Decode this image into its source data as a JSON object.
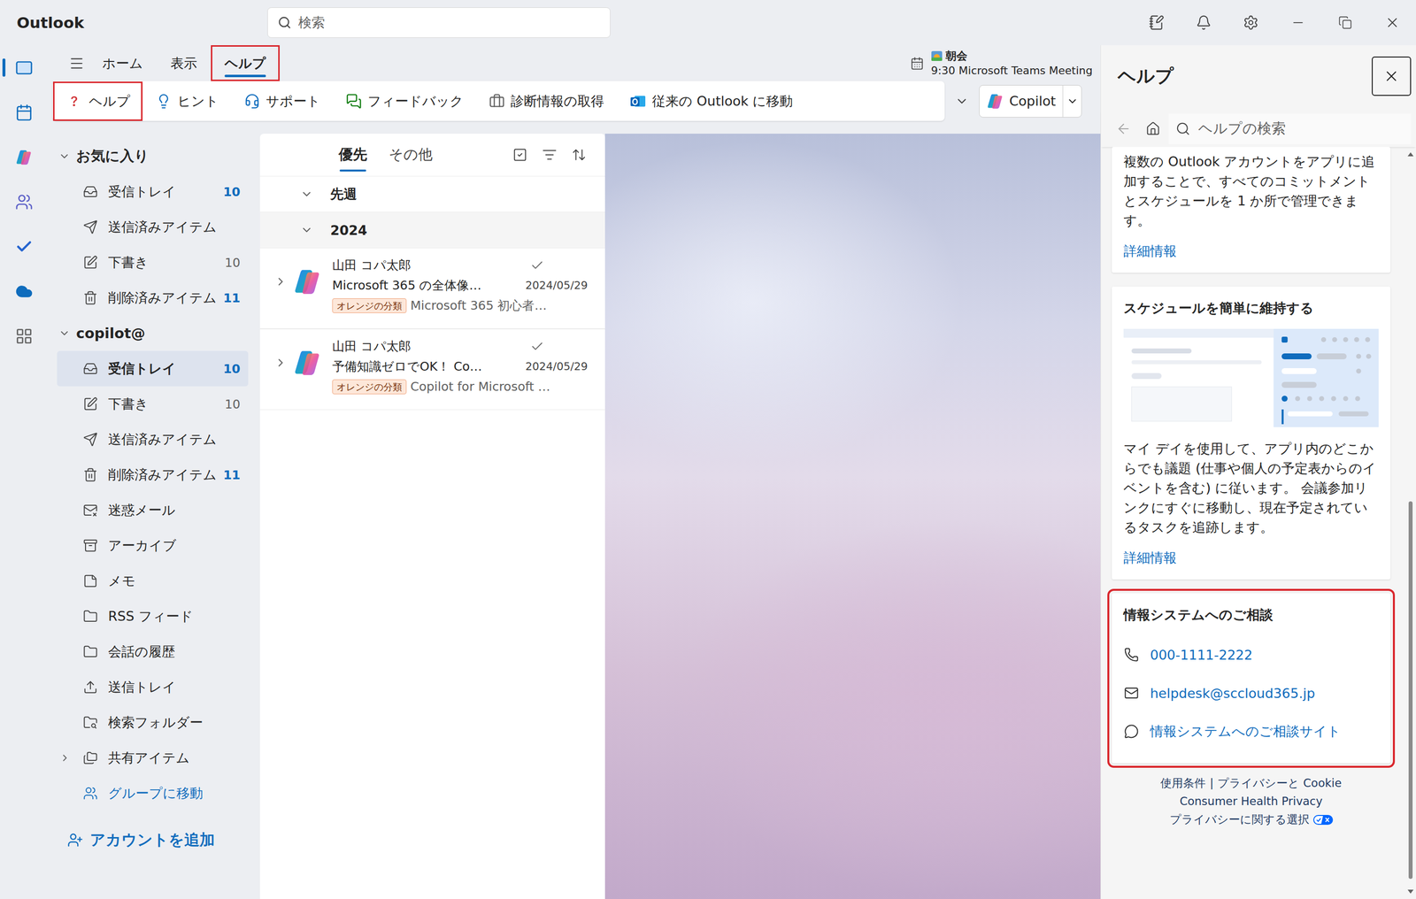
{
  "window": {
    "title": "Outlook"
  },
  "search": {
    "placeholder": "検索"
  },
  "rail": [
    {
      "kind": "mail",
      "selected": true
    },
    {
      "kind": "calendar",
      "selected": false
    },
    {
      "kind": "copilot",
      "selected": false
    },
    {
      "kind": "people",
      "selected": false
    },
    {
      "kind": "todo",
      "selected": false
    },
    {
      "kind": "onedrive",
      "selected": false
    },
    {
      "kind": "apps",
      "selected": false
    }
  ],
  "ribbon": {
    "tabs": [
      {
        "label": "ホーム",
        "selected": false,
        "highlighted": false
      },
      {
        "label": "表示",
        "selected": false,
        "highlighted": false
      },
      {
        "label": "ヘルプ",
        "selected": true,
        "highlighted": true
      }
    ],
    "buttons": [
      {
        "kind": "help",
        "label": "ヘルプ",
        "highlighted": true
      },
      {
        "kind": "tips",
        "label": "ヒント",
        "highlighted": false
      },
      {
        "kind": "support",
        "label": "サポート",
        "highlighted": false
      },
      {
        "kind": "feedback",
        "label": "フィードバック",
        "highlighted": false
      },
      {
        "kind": "diagnostics",
        "label": "診断情報の取得",
        "highlighted": false
      },
      {
        "kind": "classic",
        "label": "従来の Outlook に移動",
        "highlighted": false
      }
    ],
    "copilot": {
      "label": "Copilot"
    }
  },
  "upcoming": {
    "title": "朝会",
    "detail": "9:30 Microsoft Teams Meeting"
  },
  "folders": {
    "sections": [
      {
        "title": "お気に入り",
        "expanded": true,
        "items": [
          {
            "kind": "inbox",
            "label": "受信トレイ",
            "count": "10",
            "unread": true,
            "selected": false,
            "expandable": false
          },
          {
            "kind": "sent",
            "label": "送信済みアイテム",
            "unread": false,
            "selected": false,
            "expandable": false
          },
          {
            "kind": "drafts",
            "label": "下書き",
            "count": "10",
            "unread": false,
            "selected": false,
            "expandable": false
          },
          {
            "kind": "deleted",
            "label": "削除済みアイテム",
            "count": "11",
            "unread": true,
            "selected": false,
            "expandable": false
          }
        ]
      },
      {
        "title": "copilot@",
        "expanded": true,
        "items": [
          {
            "kind": "inbox",
            "label": "受信トレイ",
            "count": "10",
            "unread": true,
            "selected": true,
            "expandable": false
          },
          {
            "kind": "drafts",
            "label": "下書き",
            "count": "10",
            "unread": false,
            "selected": false,
            "expandable": false
          },
          {
            "kind": "sent",
            "label": "送信済みアイテム",
            "unread": false,
            "selected": false,
            "expandable": false
          },
          {
            "kind": "deleted",
            "label": "削除済みアイテム",
            "count": "11",
            "unread": true,
            "selected": false,
            "expandable": false
          },
          {
            "kind": "junk",
            "label": "迷惑メール",
            "unread": false,
            "selected": false,
            "expandable": false
          },
          {
            "kind": "archive",
            "label": "アーカイブ",
            "unread": false,
            "selected": false,
            "expandable": false
          },
          {
            "kind": "notes",
            "label": "メモ",
            "unread": false,
            "selected": false,
            "expandable": false
          },
          {
            "kind": "rss",
            "label": "RSS フィード",
            "unread": false,
            "selected": false,
            "expandable": false
          },
          {
            "kind": "history",
            "label": "会話の履歴",
            "unread": false,
            "selected": false,
            "expandable": false
          },
          {
            "kind": "outbox",
            "label": "送信トレイ",
            "unread": false,
            "selected": false,
            "expandable": false
          },
          {
            "kind": "searchfolder",
            "label": "検索フォルダー",
            "unread": false,
            "selected": false,
            "expandable": false
          },
          {
            "kind": "shared",
            "label": "共有アイテム",
            "unread": false,
            "selected": false,
            "expandable": true,
            "expanded": false
          }
        ]
      }
    ],
    "group_link": "グループに移動",
    "add_account": "アカウントを追加"
  },
  "message_list": {
    "tabs": [
      {
        "label": "優先",
        "selected": true
      },
      {
        "label": "その他",
        "selected": false
      }
    ],
    "groups": [
      {
        "label": "先週",
        "expanded": true,
        "hovered": false,
        "messages": []
      },
      {
        "label": "2024",
        "expanded": true,
        "hovered": true,
        "messages": [
          {
            "sender": "山田 コパ太郎",
            "subject": "Microsoft 365 の全体像…",
            "date": "2024/05/29",
            "category": "オレンジの分類",
            "preview": "Microsoft 365 初心者…",
            "done": true
          },
          {
            "sender": "山田 コパ太郎",
            "subject": "予備知識ゼロでOK！ Co…",
            "date": "2024/05/29",
            "category": "オレンジの分類",
            "preview": "Copilot for Microsoft …",
            "done": true
          }
        ]
      }
    ]
  },
  "help": {
    "title": "ヘルプ",
    "search_placeholder": "ヘルプの検索",
    "cards": [
      {
        "kind": "article",
        "body": "複数の Outlook アカウントをアプリに追加することで、すべてのコミットメントとスケジュールを 1 か所で管理できます。",
        "link": "詳細情報",
        "illustration": false,
        "highlighted": false
      },
      {
        "kind": "article",
        "title": "スケジュールを簡単に維持する",
        "body": "マイ デイを使用して、アプリ内のどこからでも議題 (仕事や個人の予定表からのイベントを含む) に従います。 会議参加リンクにすぐに移動し、現在予定されているタスクを追跡します。",
        "link": "詳細情報",
        "illustration": true,
        "highlighted": false
      },
      {
        "kind": "contact",
        "title": "情報システムへのご相談",
        "highlighted": true,
        "contacts": [
          {
            "kind": "phone",
            "label": "000-1111-2222"
          },
          {
            "kind": "email",
            "label": "helpdesk@sccloud365.jp"
          },
          {
            "kind": "chat",
            "label": "情報システムへのご相談サイト"
          }
        ]
      }
    ],
    "footer": {
      "links": [
        "使用条件",
        "プライバシーと Cookie"
      ],
      "separator": "|",
      "health": "Consumer Health Privacy",
      "choices": "プライバシーに関する選択"
    },
    "scrollbar": {
      "offset": 0.47,
      "size": 0.52
    }
  }
}
